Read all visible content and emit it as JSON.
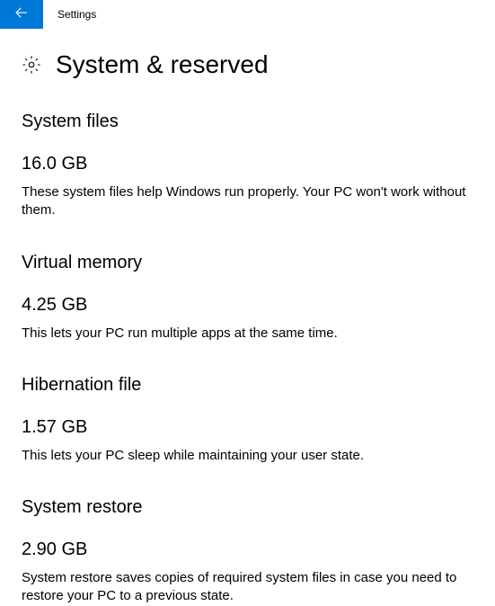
{
  "header": {
    "title": "Settings"
  },
  "page": {
    "title": "System & reserved"
  },
  "sections": {
    "system_files": {
      "title": "System files",
      "value": "16.0 GB",
      "description": "These system files help Windows run properly. Your PC won't work without them."
    },
    "virtual_memory": {
      "title": "Virtual memory",
      "value": "4.25 GB",
      "description": "This lets your PC run multiple apps at the same time."
    },
    "hibernation_file": {
      "title": "Hibernation file",
      "value": "1.57 GB",
      "description": "This lets your PC sleep while maintaining your user state."
    },
    "system_restore": {
      "title": "System restore",
      "value": "2.90 GB",
      "description": "System restore saves copies of required system files in case you need to restore your PC to a previous state."
    }
  }
}
